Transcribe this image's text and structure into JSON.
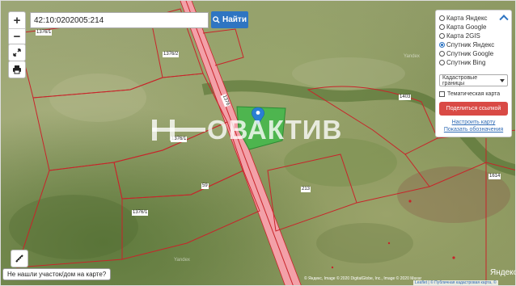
{
  "map": {
    "search_value": "42:10:0202005:214",
    "search_button_label": "Найти",
    "zoom_in_label": "+",
    "zoom_out_label": "−",
    "fullscreen_icon": "expand-icon",
    "print_icon": "printer-icon",
    "ruler_icon": "ruler-icon",
    "not_found_label": "Не нашли участок/дом на карте?",
    "watermark_text": "ОВАКТИВ",
    "plot_labels": [
      "1376/1",
      "1376/2",
      "1376",
      "1376/1",
      "59",
      "1376/1",
      "213",
      "1403",
      "1614"
    ],
    "attribution": "© Яндекс, Image © 2020 DigitalGlobe, Inc., Image © 2020 Maxar",
    "attribution2": "Leaflet | © Публичная кадастровая карта, ©",
    "yandex_logo": "Яндекс",
    "provider_mark": "Yandex",
    "highlight_color": "#41b84a",
    "boundary_color": "#c8242a",
    "road_color": "#f3a0a8"
  },
  "layers": {
    "options": [
      {
        "label": "Карта Яндекс",
        "selected": false
      },
      {
        "label": "Карта Google",
        "selected": false
      },
      {
        "label": "Карта 2GIS",
        "selected": false
      },
      {
        "label": "Спутник Яндекс",
        "selected": true
      },
      {
        "label": "Спутник Google",
        "selected": false
      },
      {
        "label": "Спутник Bing",
        "selected": false
      }
    ],
    "overlay_select": "Кадастровые границы",
    "thematic_label": "Тематическая карта",
    "share_label": "Поделиться ссылкой",
    "configure_link": "Настроить карту",
    "legend_link": "Показать обозначения"
  }
}
